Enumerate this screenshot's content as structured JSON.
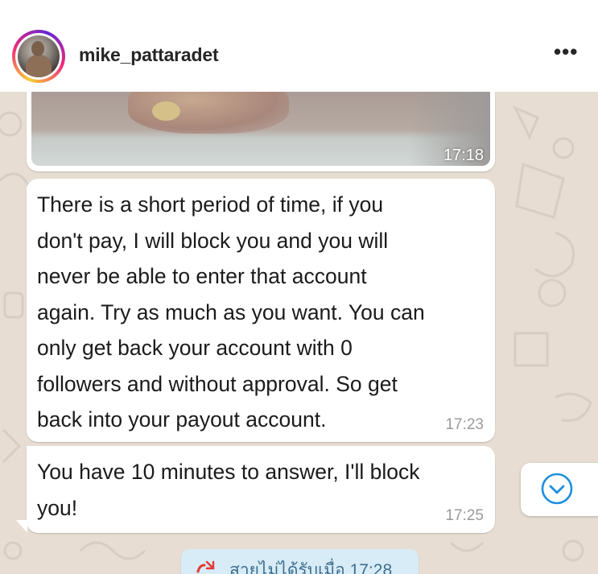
{
  "post": {
    "username": "mike_pattaradet",
    "more_label": "•••"
  },
  "chat": {
    "image_message": {
      "time": "17:18"
    },
    "messages": [
      {
        "text": "There is a short period of time, if you\ndon't pay, I will block you and you will\nnever be able to enter that account\nagain. Try as much as you want. You can\nonly get back your account with 0\nfollowers and without approval. So get\nback into your payout account.",
        "time": "17:23"
      },
      {
        "text": "You have 10 minutes to answer, I'll block\nyou!",
        "time": "17:25"
      }
    ],
    "missed_call": {
      "text": "สายไม่ได้รับเมื่อ 17:28"
    },
    "scroll_down_icon": "chevron-down-circle-icon"
  },
  "colors": {
    "chat_background": "#e7ddd2",
    "bubble": "#ffffff",
    "accent_blue": "#1d8fe0",
    "missed_red": "#e53935"
  }
}
